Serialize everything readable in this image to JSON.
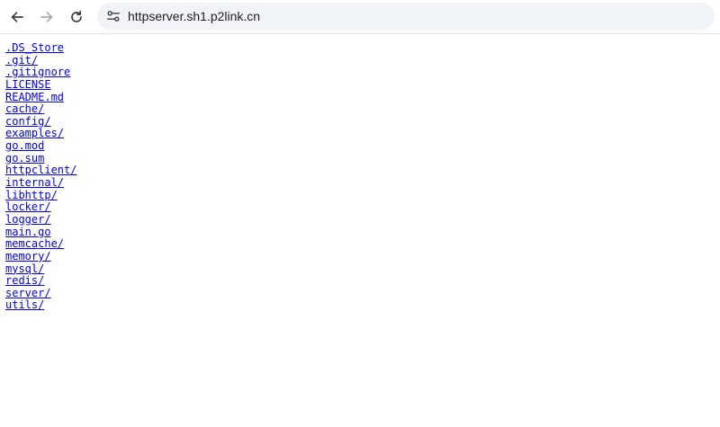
{
  "toolbar": {
    "back_icon": "arrow-left-icon",
    "forward_icon": "arrow-right-icon",
    "reload_icon": "reload-icon",
    "site_info_icon": "tune-icon",
    "url": "httpserver.sh1.p2link.cn"
  },
  "listing": {
    "link_color": "#0000ee",
    "items": [
      ".DS_Store",
      ".git/",
      ".gitignore",
      "LICENSE",
      "README.md",
      "cache/",
      "config/",
      "examples/",
      "go.mod",
      "go.sum",
      "httpclient/",
      "internal/",
      "libhttp/",
      "locker/",
      "logger/",
      "main.go",
      "memcache/",
      "memory/",
      "mysql/",
      "redis/",
      "server/",
      "utils/"
    ]
  }
}
